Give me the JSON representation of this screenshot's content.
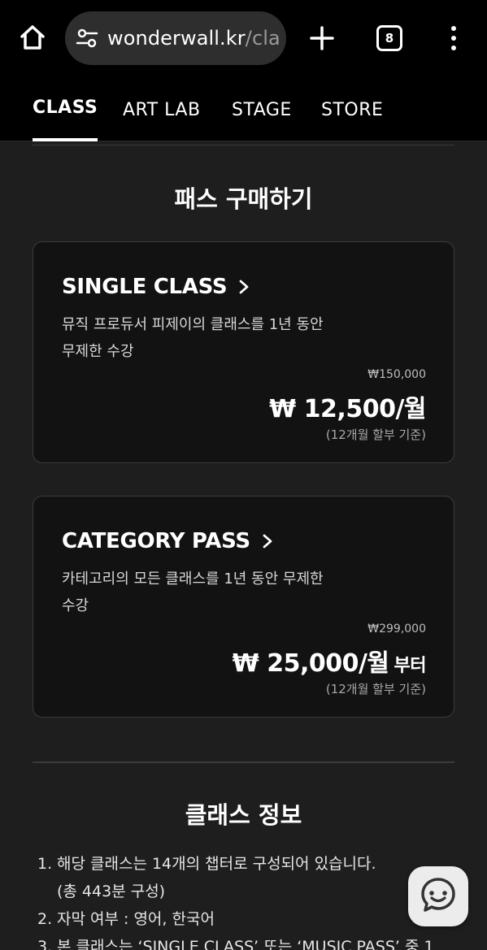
{
  "browser": {
    "url_host": "wonderwall.kr",
    "url_path": "/cla",
    "tab_count": "8",
    "icons": [
      "home-icon",
      "site-settings-icon",
      "new-tab-icon",
      "tab-switcher-icon",
      "more-menu-icon"
    ]
  },
  "nav": {
    "items": [
      {
        "label": "CLASS",
        "active": true
      },
      {
        "label": "ART LAB",
        "active": false
      },
      {
        "label": "STAGE",
        "active": false
      },
      {
        "label": "STORE",
        "active": false
      }
    ]
  },
  "pass_section": {
    "title": "패스 구매하기",
    "cards": [
      {
        "title": "SINGLE CLASS",
        "desc_line1": "뮤직 프로듀서 피제이의 클래스를 1년 동안",
        "desc_line2": "무제한 수강",
        "original_price": "₩150,000",
        "price": "₩ 12,500/월",
        "price_suffix": "",
        "installment": "(12개월 할부 기준)"
      },
      {
        "title": "CATEGORY PASS",
        "desc_line1": "카테고리의 모든 클래스를 1년 동안 무제한",
        "desc_line2": "수강",
        "original_price": "₩299,000",
        "price": "₩ 25,000/월",
        "price_suffix": "부터",
        "installment": "(12개월 할부 기준)"
      }
    ]
  },
  "info_section": {
    "title": "클래스 정보",
    "items": [
      {
        "num": "1.",
        "text": "해당 클래스는 14개의 챕터로 구성되어 있습니다.",
        "sub": "(총 443분 구성)"
      },
      {
        "num": "2.",
        "text": "자막 여부 : 영어, 한국어"
      },
      {
        "num": "3.",
        "text": "본 클래스는 ‘SINGLE CLASS’ 또는 ‘MUSIC PASS’ 중 1"
      }
    ]
  },
  "colors": {
    "background": "#1e1e1e",
    "card_background": "#121212",
    "card_border": "#3c3c3c",
    "chat_button": "#ececec"
  },
  "chat": {
    "icon": "chat-icon"
  }
}
